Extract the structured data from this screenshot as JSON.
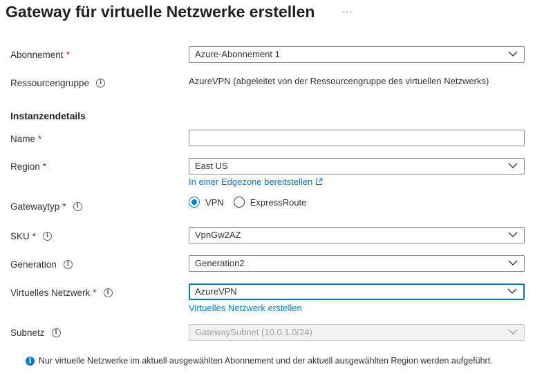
{
  "header": {
    "title": "Gateway für virtuelle Netzwerke erstellen",
    "more": "···"
  },
  "required_marker": "*",
  "info_glyph": "i",
  "subscription": {
    "label": "Abonnement",
    "value": "Azure-Abonnement 1"
  },
  "resource_group": {
    "label": "Ressourcengruppe",
    "value": "AzureVPN (abgeleitet von der Ressourcengruppe des virtuellen Netzwerks)"
  },
  "instance_details": {
    "heading": "Instanzendetails"
  },
  "name": {
    "label": "Name",
    "value": ""
  },
  "region": {
    "label": "Region",
    "value": "East US",
    "link": "In einer Edgezone bereitstellen"
  },
  "gateway_type": {
    "label": "Gatewaytyp",
    "options": [
      "VPN",
      "ExpressRoute"
    ],
    "selected": "VPN"
  },
  "sku": {
    "label": "SKU",
    "value": "VpnGw2AZ"
  },
  "generation": {
    "label": "Generation",
    "value": "Generation2"
  },
  "virtual_network": {
    "label": "Virtuelles Netzwerk",
    "value": "AzureVPN",
    "link": "Virtuelles Netzwerk erstellen"
  },
  "subnet": {
    "label": "Subnetz",
    "value": "GatewaySubnet (10.0.1.0/24)"
  },
  "footer_note": "Nur virtuelle Netzwerke im aktuell ausgewählten Abonnement und der aktuell ausgewählten Region werden aufgeführt.",
  "colors": {
    "accent": "#0078d4",
    "required": "#a4262c",
    "disabled_bg": "#f3f2f1"
  }
}
